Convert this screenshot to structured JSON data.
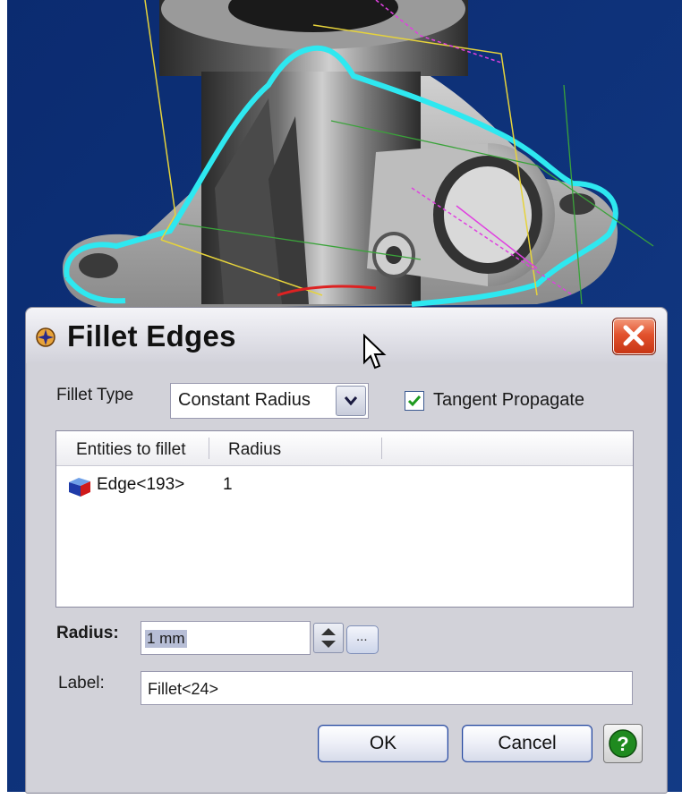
{
  "dialog": {
    "title": "Fillet Edges",
    "close_icon": "close-icon",
    "app_icon": "catia-app-icon"
  },
  "fillet_type": {
    "label": "Fillet Type",
    "value": "Constant Radius",
    "dropdown_icon": "chevron-down-icon"
  },
  "tangent_propagate": {
    "label": "Tangent Propagate",
    "checked": true
  },
  "entities_table": {
    "columns": [
      "Entities to fillet",
      "Radius"
    ],
    "rows": [
      {
        "entity": "Edge<193>",
        "radius": "1",
        "icon": "edge-icon"
      }
    ]
  },
  "radius": {
    "label": "Radius:",
    "value": "1 mm",
    "more_button": "..."
  },
  "label_field": {
    "label": "Label:",
    "value": "Fillet<24>"
  },
  "buttons": {
    "ok": "OK",
    "cancel": "Cancel",
    "help_icon": "help-icon"
  },
  "colors": {
    "viewport_background": "#0d2a66",
    "selection_highlight": "#2ee8f0",
    "dialog_background": "#d2d2d9",
    "close_button": "#d84320",
    "help_button": "#1f8a1f"
  }
}
